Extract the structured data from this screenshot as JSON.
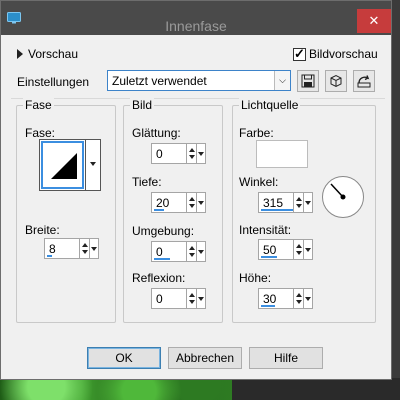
{
  "window": {
    "title": "Innenfase",
    "close_glyph": "✕"
  },
  "top": {
    "preview_label": "Vorschau",
    "bildvorschau_label": "Bildvorschau",
    "bildvorschau_checked": true,
    "settings_label": "Einstellungen",
    "settings_value": "Zuletzt verwendet"
  },
  "groups": {
    "fase": {
      "title": "Fase",
      "fase_label": "Fase:",
      "breite_label": "Breite:",
      "breite_value": "8"
    },
    "bild": {
      "title": "Bild",
      "glaettung_label": "Glättung:",
      "glaettung_value": "0",
      "tiefe_label": "Tiefe:",
      "tiefe_value": "20",
      "umgebung_label": "Umgebung:",
      "umgebung_value": "0",
      "reflexion_label": "Reflexion:",
      "reflexion_value": "0"
    },
    "licht": {
      "title": "Lichtquelle",
      "farbe_label": "Farbe:",
      "farbe_color": "#ffffff",
      "winkel_label": "Winkel:",
      "winkel_value": "315",
      "intensitaet_label": "Intensität:",
      "intensitaet_value": "50",
      "hoehe_label": "Höhe:",
      "hoehe_value": "30"
    }
  },
  "buttons": {
    "ok": "OK",
    "cancel": "Abbrechen",
    "help": "Hilfe"
  },
  "icons": [
    "app-icon",
    "save-preset-icon",
    "delete-preset-icon",
    "reset-icon",
    "bevel-preview-icon",
    "angle-dial-icon"
  ],
  "colors": {
    "accent": "#3b8ee0",
    "titlebar": "#4a4a4a",
    "close": "#c63c3c"
  }
}
